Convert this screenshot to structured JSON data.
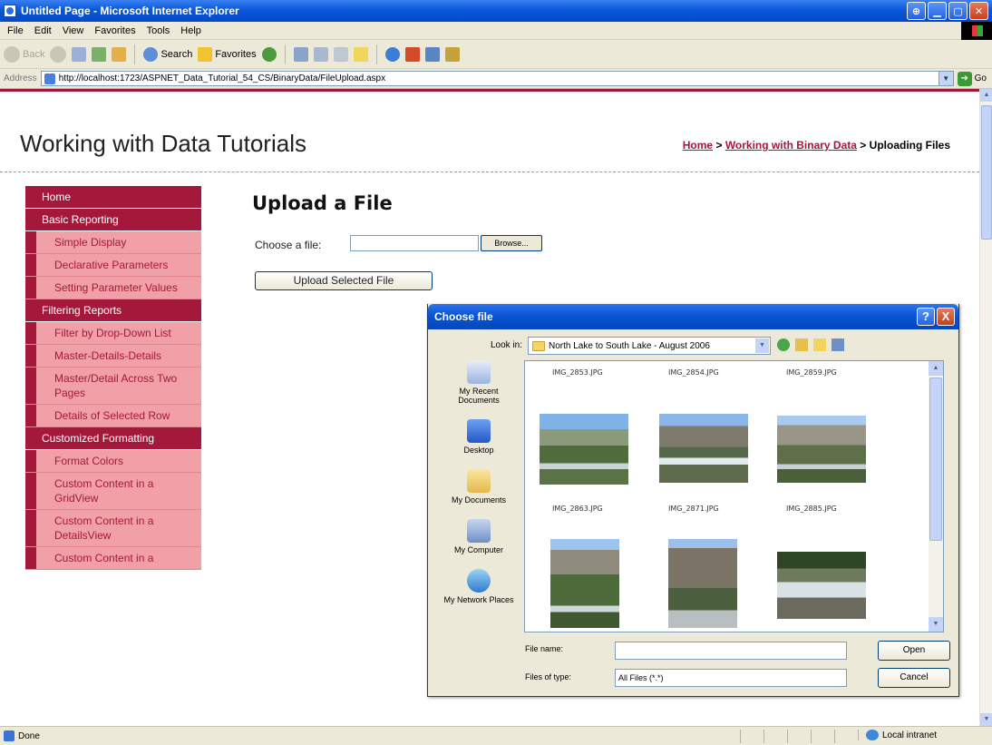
{
  "window": {
    "title": "Untitled Page - Microsoft Internet Explorer"
  },
  "menu": [
    "File",
    "Edit",
    "View",
    "Favorites",
    "Tools",
    "Help"
  ],
  "toolbar": {
    "back": "Back",
    "search": "Search",
    "favorites": "Favorites"
  },
  "address": {
    "label": "Address",
    "url": "http://localhost:1723/ASPNET_Data_Tutorial_54_CS/BinaryData/FileUpload.aspx",
    "go": "Go"
  },
  "site": {
    "title": "Working with Data Tutorials"
  },
  "breadcrumb": {
    "home": "Home",
    "sep1": ">",
    "section": "Working with Binary Data",
    "sep2": ">",
    "current": "Uploading Files"
  },
  "sidebar": [
    {
      "type": "head",
      "label": "Home"
    },
    {
      "type": "head",
      "label": "Basic Reporting"
    },
    {
      "type": "item",
      "label": "Simple Display"
    },
    {
      "type": "item",
      "label": "Declarative Parameters"
    },
    {
      "type": "item",
      "label": "Setting Parameter Values"
    },
    {
      "type": "head",
      "label": "Filtering Reports"
    },
    {
      "type": "item",
      "label": "Filter by Drop-Down List"
    },
    {
      "type": "item",
      "label": "Master-Details-Details"
    },
    {
      "type": "item",
      "label": "Master/Detail Across Two Pages"
    },
    {
      "type": "item",
      "label": "Details of Selected Row"
    },
    {
      "type": "head",
      "label": "Customized Formatting"
    },
    {
      "type": "item",
      "label": "Format Colors"
    },
    {
      "type": "item",
      "label": "Custom Content in a GridView"
    },
    {
      "type": "item",
      "label": "Custom Content in a DetailsView"
    },
    {
      "type": "item",
      "label": "Custom Content in a"
    }
  ],
  "main": {
    "heading": "Upload a File",
    "choose_label": "Choose a file:",
    "browse_label": "Browse...",
    "upload_label": "Upload Selected File"
  },
  "dialog": {
    "title": "Choose file",
    "help": "?",
    "close": "X",
    "lookin_label": "Look in:",
    "lookin_value": "North Lake to South Lake - August 2006",
    "places": [
      "My Recent Documents",
      "Desktop",
      "My Documents",
      "My Computer",
      "My Network Places"
    ],
    "files": [
      "IMG_2853.JPG",
      "IMG_2854.JPG",
      "IMG_2859.JPG",
      "IMG_2863.JPG",
      "IMG_2871.JPG",
      "IMG_2885.JPG"
    ],
    "filename_label": "File name:",
    "filename_value": "",
    "filetype_label": "Files of type:",
    "filetype_value": "All Files (*.*)",
    "open_label": "Open",
    "cancel_label": "Cancel"
  },
  "status": {
    "left": "Done",
    "zone": "Local intranet"
  }
}
